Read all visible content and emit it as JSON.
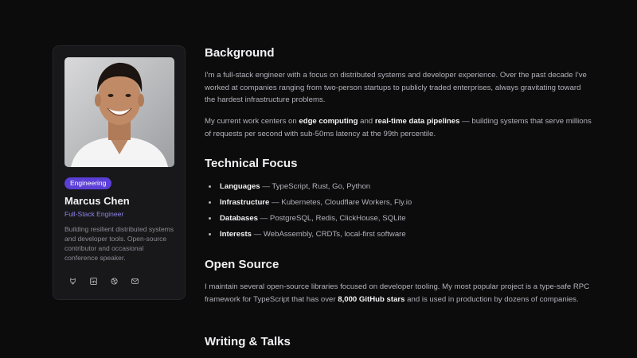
{
  "profile": {
    "badge": "Engineering",
    "name": "Marcus Chen",
    "role": "Full-Stack Engineer",
    "bio": "Building resilient distributed systems and developer tools. Open-source contributor and occasional conference speaker.",
    "socials": [
      {
        "icon": "github-icon"
      },
      {
        "icon": "linkedin-icon"
      },
      {
        "icon": "dribbble-icon"
      },
      {
        "icon": "mail-icon"
      }
    ]
  },
  "sections": {
    "background": {
      "heading": "Background",
      "p1": "I'm a full-stack engineer with a focus on distributed systems and developer experience. Over the past decade I've worked at companies ranging from two-person startups to publicly traded enterprises, always gravitating toward the hardest infrastructure problems.",
      "p2_a": "My current work centers on ",
      "p2_b": "edge computing",
      "p2_c": " and ",
      "p2_d": "real-time data pipelines",
      "p2_e": " — building systems that serve millions of requests per second with sub-50ms latency at the 99th percentile."
    },
    "technical": {
      "heading": "Technical Focus",
      "items": [
        {
          "label": "Languages",
          "text": " — TypeScript, Rust, Go, Python"
        },
        {
          "label": "Infrastructure",
          "text": " — Kubernetes, Cloudflare Workers, Fly.io"
        },
        {
          "label": "Databases",
          "text": " — PostgreSQL, Redis, ClickHouse, SQLite"
        },
        {
          "label": "Interests",
          "text": " — WebAssembly, CRDTs, local-first software"
        }
      ]
    },
    "open_source": {
      "heading": "Open Source",
      "p_a": "I maintain several open-source libraries focused on developer tooling. My most popular project is a type-safe RPC framework for TypeScript that has over ",
      "p_b": "8,000 GitHub stars",
      "p_c": " and is used in production by dozens of companies."
    },
    "writing": {
      "heading": "Writing & Talks"
    }
  },
  "colors": {
    "background": "#0c0c0d",
    "card": "#18181b",
    "accent": "#5b3fd6",
    "role": "#8f83e8"
  }
}
